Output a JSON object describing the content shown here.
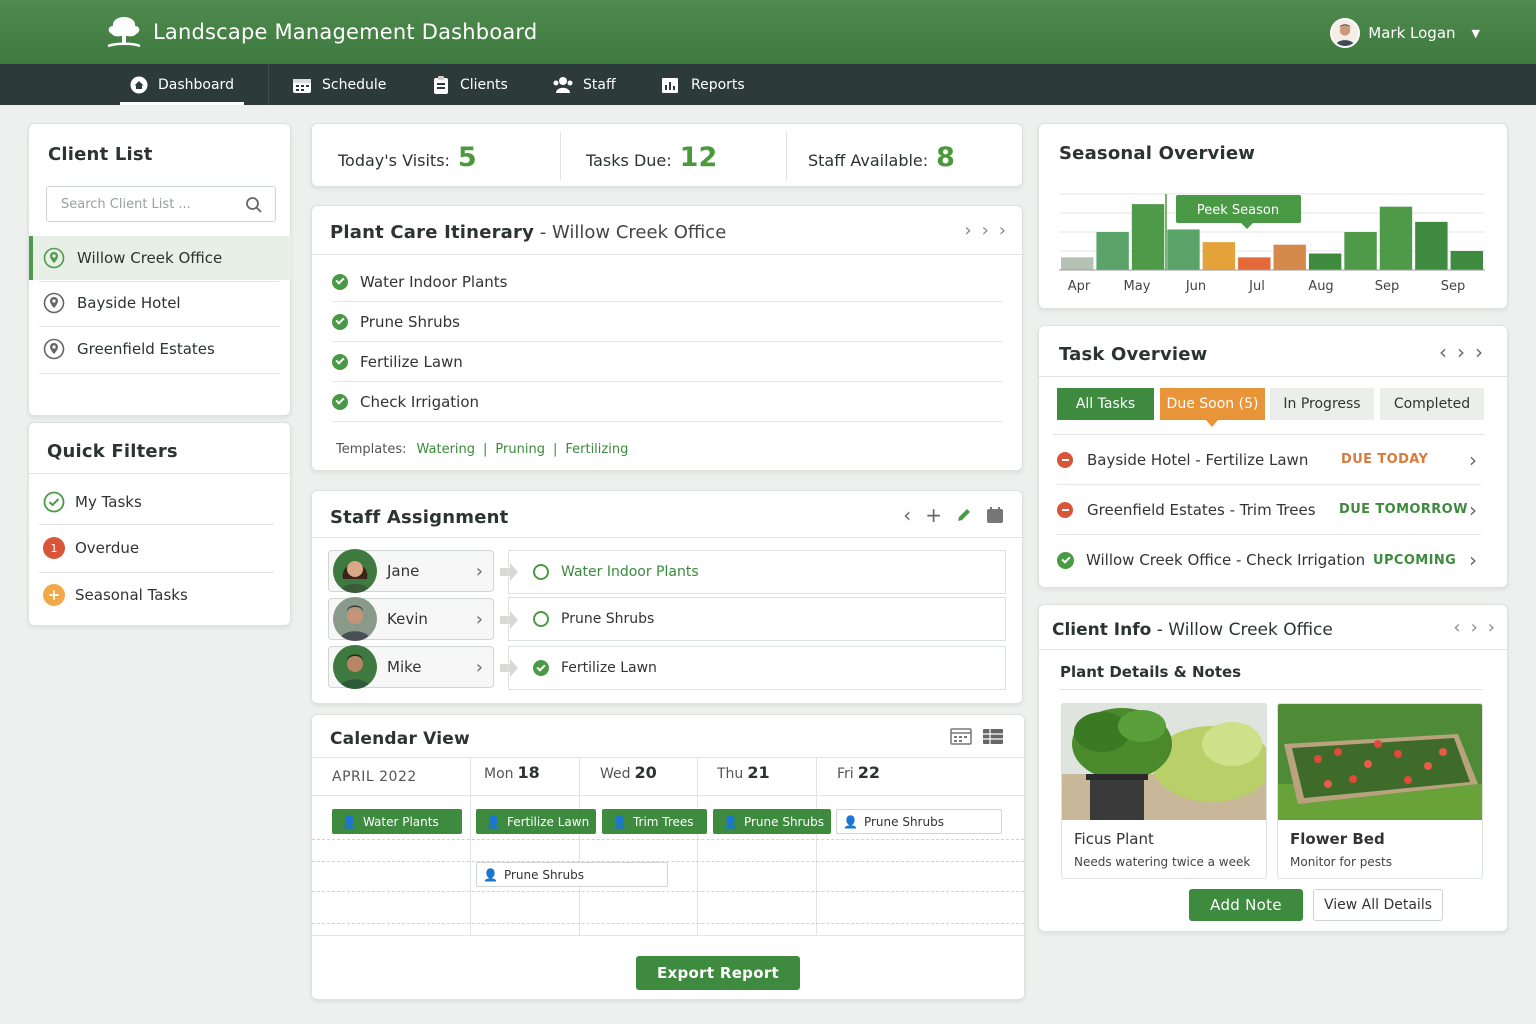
{
  "app": {
    "title": "Landscape Management Dashboard"
  },
  "user": {
    "name": "Mark Logan"
  },
  "nav": [
    {
      "label": "Dashboard",
      "icon": "home-icon"
    },
    {
      "label": "Schedule",
      "icon": "calendar-icon"
    },
    {
      "label": "Clients",
      "icon": "clipboard-icon"
    },
    {
      "label": "Staff",
      "icon": "people-icon"
    },
    {
      "label": "Reports",
      "icon": "report-icon"
    }
  ],
  "client_list": {
    "title": "Client List",
    "search_placeholder": "Search Client List ...",
    "items": [
      "Willow Creek Office",
      "Bayside Hotel",
      "Greenfield Estates"
    ]
  },
  "quick_filters": {
    "title": "Quick Filters",
    "items": [
      {
        "label": "My Tasks",
        "icon": "check-circle-icon"
      },
      {
        "label": "Overdue",
        "icon": "alert-badge-icon",
        "badge": "1"
      },
      {
        "label": "Seasonal Tasks",
        "icon": "plus-circle-icon"
      }
    ]
  },
  "stats": {
    "visits_label": "Today's Visits:",
    "visits": "5",
    "tasks_label": "Tasks Due:",
    "tasks": "12",
    "staff_label": "Staff Available:",
    "staff": "8"
  },
  "itinerary": {
    "title": "Plant Care Itinerary",
    "location": "Willow Creek Office",
    "sep": "-",
    "tasks": [
      "Water Indoor Plants",
      "Prune Shrubs",
      "Fertilize Lawn",
      "Check Irrigation"
    ],
    "templates_label": "Templates:",
    "templates": [
      "Watering",
      "Pruning",
      "Fertilizing"
    ],
    "pipe": "|"
  },
  "staff_assignment": {
    "title": "Staff Assignment",
    "rows": [
      {
        "name": "Jane",
        "task": "Water Indoor Plants"
      },
      {
        "name": "Kevin",
        "task": "Prune Shrubs"
      },
      {
        "name": "Mike",
        "task": "Fertilize Lawn"
      }
    ]
  },
  "calendar": {
    "title": "Calendar View",
    "month": "APRIL 2022",
    "days": [
      {
        "dow": "Mon",
        "num": "18"
      },
      {
        "dow": "Wed",
        "num": "20"
      },
      {
        "dow": "Thu",
        "num": "21"
      },
      {
        "dow": "Fri",
        "num": "22"
      }
    ],
    "events": [
      "Water Plants",
      "Fertilize Lawn",
      "Trim Trees",
      "Prune Shrubs",
      "Prune Shrubs",
      "Prune Shrubs"
    ],
    "export_label": "Export Report"
  },
  "seasonal": {
    "title": "Seasonal Overview",
    "peak_label": "Peek Season",
    "months": [
      "Apr",
      "May",
      "Jun",
      "Jul",
      "Aug",
      "Sep",
      "Sep"
    ]
  },
  "chart_data": {
    "type": "bar",
    "title": "Seasonal Overview",
    "annotation": "Peek Season",
    "categories": [
      "Apr",
      "May",
      "Jun",
      "Jul",
      "Aug",
      "Sep",
      "Sep"
    ],
    "values": [
      10,
      30,
      52,
      32,
      22,
      10,
      20,
      13,
      30,
      50,
      38,
      15
    ],
    "colors": [
      "#b7c2b7",
      "#5aa469",
      "#4f9a48",
      "#5aa469",
      "#e4a23a",
      "#e56a3a",
      "#d48a4a",
      "#3e8a3f",
      "#4f9a48",
      "#4f9a48",
      "#3e8a3f",
      "#3e8a3f"
    ],
    "ylim": [
      0,
      60
    ]
  },
  "task_overview": {
    "title": "Task Overview",
    "tabs": [
      "All Tasks",
      "Due Soon (5)",
      "In Progress",
      "Completed"
    ],
    "rows": [
      {
        "label": "Bayside Hotel - Fertilize Lawn",
        "status": "DUE TODAY",
        "status_color": "#d9793a"
      },
      {
        "label": "Greenfield Estates - Trim Trees",
        "status": "DUE TOMORROW",
        "status_color": "#3e8a3f"
      },
      {
        "label": "Willow Creek Office - Check Irrigation",
        "status": "UPCOMING",
        "status_color": "#3e8a3f"
      }
    ]
  },
  "client_info": {
    "title": "Client Info",
    "location": "Willow Creek Office",
    "sep": "-",
    "section": "Plant Details & Notes",
    "plants": [
      {
        "name": "Ficus Plant",
        "note": "Needs watering twice a week"
      },
      {
        "name": "Flower Bed",
        "note": "Monitor for pests"
      }
    ],
    "add_note": "Add Note",
    "view_all": "View All Details"
  },
  "colors": {
    "brand": "#3e7a3f",
    "nav": "#2d3a3a",
    "accent": "#4a9a3c",
    "warn": "#d9793a"
  }
}
